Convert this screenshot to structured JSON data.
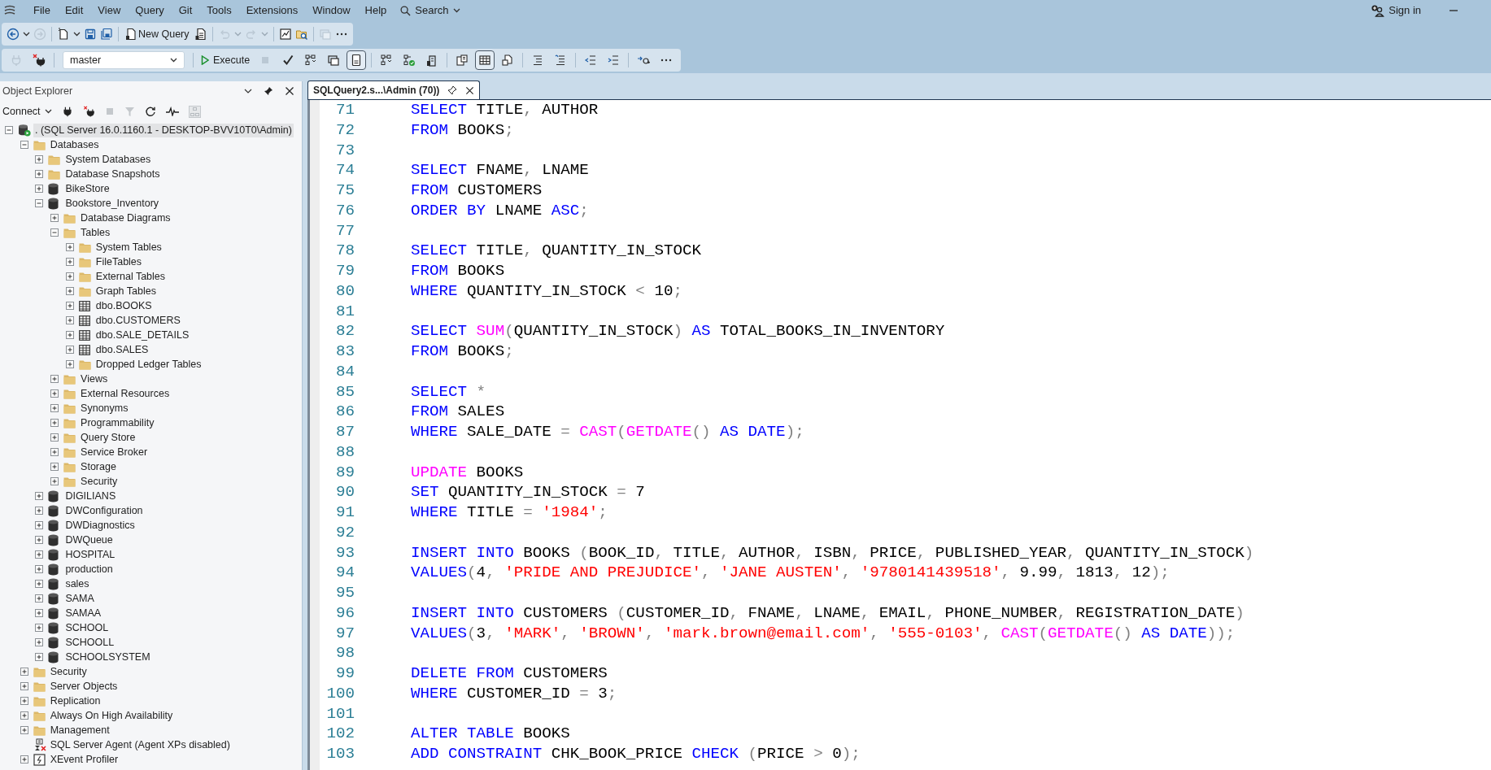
{
  "menu_bar": {
    "items": [
      "File",
      "Edit",
      "View",
      "Query",
      "Git",
      "Tools",
      "Extensions",
      "Window",
      "Help"
    ],
    "search": "Search",
    "sign_in": "Sign in"
  },
  "toolbar_1": [
    {
      "kind": "back",
      "disabled": false
    },
    {
      "kind": "dropdown",
      "disabled": false
    },
    {
      "kind": "forward",
      "disabled": true
    },
    {
      "kind": "separator"
    },
    {
      "kind": "new-file",
      "disabled": false
    },
    {
      "kind": "dropdown",
      "disabled": false
    },
    {
      "kind": "save",
      "disabled": false
    },
    {
      "kind": "save-all",
      "disabled": false
    },
    {
      "kind": "separator"
    },
    {
      "kind": "new-query",
      "label": "New Query",
      "disabled": false
    },
    {
      "kind": "document",
      "disabled": false
    },
    {
      "kind": "separator"
    },
    {
      "kind": "undo",
      "disabled": true
    },
    {
      "kind": "dropdown",
      "disabled": true
    },
    {
      "kind": "redo",
      "disabled": true
    },
    {
      "kind": "dropdown",
      "disabled": true
    },
    {
      "kind": "separator"
    },
    {
      "kind": "report",
      "disabled": false
    },
    {
      "kind": "open-folder",
      "disabled": false
    },
    {
      "kind": "separator"
    },
    {
      "kind": "window",
      "disabled": true
    },
    {
      "kind": "more",
      "disabled": false
    }
  ],
  "toolbar_2": [
    {
      "kind": "plug",
      "disabled": true
    },
    {
      "kind": "disconnect",
      "disabled": false
    },
    {
      "kind": "separator"
    },
    {
      "kind": "database-select",
      "value": "master"
    },
    {
      "kind": "separator"
    },
    {
      "kind": "execute",
      "label": "Execute",
      "disabled": false
    },
    {
      "kind": "stop",
      "disabled": true
    },
    {
      "kind": "check",
      "disabled": false
    },
    {
      "kind": "plan",
      "disabled": false,
      "selected": false
    },
    {
      "kind": "window",
      "disabled": false,
      "selected": false
    },
    {
      "kind": "form",
      "disabled": false,
      "selected": true
    },
    {
      "kind": "separator"
    },
    {
      "kind": "plan",
      "disabled": false,
      "selected": false
    },
    {
      "kind": "plan-check",
      "disabled": false,
      "selected": false
    },
    {
      "kind": "chart",
      "disabled": false,
      "selected": false
    },
    {
      "kind": "separator"
    },
    {
      "kind": "text",
      "disabled": false,
      "selected": false
    },
    {
      "kind": "grid",
      "disabled": false,
      "selected": true
    },
    {
      "kind": "file",
      "disabled": false,
      "selected": false
    },
    {
      "kind": "separator"
    },
    {
      "kind": "comment",
      "disabled": false
    },
    {
      "kind": "uncomment",
      "disabled": false
    },
    {
      "kind": "separator"
    },
    {
      "kind": "outdent",
      "disabled": false
    },
    {
      "kind": "indent",
      "disabled": false
    },
    {
      "kind": "separator"
    },
    {
      "kind": "parameters",
      "disabled": false
    },
    {
      "kind": "more",
      "disabled": false
    }
  ],
  "object_explorer": {
    "title": "Object Explorer",
    "connect": "Connect",
    "tree": [
      {
        "label": ". (SQL Server 16.0.1160.1 - DESKTOP-BVV10T0\\Admin)",
        "kind": "server",
        "expanded": true,
        "selected": true,
        "children": [
          {
            "label": "Databases",
            "kind": "folder",
            "expanded": true,
            "selected": false,
            "children": [
              {
                "label": "System Databases",
                "kind": "folder",
                "expanded": false,
                "selected": false
              },
              {
                "label": "Database Snapshots",
                "kind": "folder",
                "expanded": false,
                "selected": false
              },
              {
                "label": "BikeStore",
                "kind": "database",
                "expanded": false,
                "selected": false
              },
              {
                "label": "Bookstore_Inventory",
                "kind": "database",
                "expanded": true,
                "selected": false,
                "children": [
                  {
                    "label": "Database Diagrams",
                    "kind": "folder",
                    "expanded": false,
                    "selected": false
                  },
                  {
                    "label": "Tables",
                    "kind": "folder",
                    "expanded": true,
                    "selected": false,
                    "children": [
                      {
                        "label": "System Tables",
                        "kind": "folder",
                        "expanded": false,
                        "selected": false
                      },
                      {
                        "label": "FileTables",
                        "kind": "folder",
                        "expanded": false,
                        "selected": false
                      },
                      {
                        "label": "External Tables",
                        "kind": "folder",
                        "expanded": false,
                        "selected": false
                      },
                      {
                        "label": "Graph Tables",
                        "kind": "folder",
                        "expanded": false,
                        "selected": false
                      },
                      {
                        "label": "dbo.BOOKS",
                        "kind": "table",
                        "expanded": false,
                        "selected": false
                      },
                      {
                        "label": "dbo.CUSTOMERS",
                        "kind": "table",
                        "expanded": false,
                        "selected": false
                      },
                      {
                        "label": "dbo.SALE_DETAILS",
                        "kind": "table",
                        "expanded": false,
                        "selected": false
                      },
                      {
                        "label": "dbo.SALES",
                        "kind": "table",
                        "expanded": false,
                        "selected": false
                      },
                      {
                        "label": "Dropped Ledger Tables",
                        "kind": "folder",
                        "expanded": false,
                        "selected": false
                      }
                    ]
                  },
                  {
                    "label": "Views",
                    "kind": "folder",
                    "expanded": false,
                    "selected": false
                  },
                  {
                    "label": "External Resources",
                    "kind": "folder",
                    "expanded": false,
                    "selected": false
                  },
                  {
                    "label": "Synonyms",
                    "kind": "folder",
                    "expanded": false,
                    "selected": false
                  },
                  {
                    "label": "Programmability",
                    "kind": "folder",
                    "expanded": false,
                    "selected": false
                  },
                  {
                    "label": "Query Store",
                    "kind": "folder",
                    "expanded": false,
                    "selected": false
                  },
                  {
                    "label": "Service Broker",
                    "kind": "folder",
                    "expanded": false,
                    "selected": false
                  },
                  {
                    "label": "Storage",
                    "kind": "folder",
                    "expanded": false,
                    "selected": false
                  },
                  {
                    "label": "Security",
                    "kind": "folder",
                    "expanded": false,
                    "selected": false
                  }
                ]
              },
              {
                "label": "DIGILIANS",
                "kind": "database",
                "expanded": false,
                "selected": false
              },
              {
                "label": "DWConfiguration",
                "kind": "database",
                "expanded": false,
                "selected": false
              },
              {
                "label": "DWDiagnostics",
                "kind": "database",
                "expanded": false,
                "selected": false
              },
              {
                "label": "DWQueue",
                "kind": "database",
                "expanded": false,
                "selected": false
              },
              {
                "label": "HOSPITAL",
                "kind": "database",
                "expanded": false,
                "selected": false
              },
              {
                "label": "production",
                "kind": "database",
                "expanded": false,
                "selected": false
              },
              {
                "label": "sales",
                "kind": "database",
                "expanded": false,
                "selected": false
              },
              {
                "label": "SAMA",
                "kind": "database",
                "expanded": false,
                "selected": false
              },
              {
                "label": "SAMAA",
                "kind": "database",
                "expanded": false,
                "selected": false
              },
              {
                "label": "SCHOOL",
                "kind": "database",
                "expanded": false,
                "selected": false
              },
              {
                "label": "SCHOOLL",
                "kind": "database",
                "expanded": false,
                "selected": false
              },
              {
                "label": "SCHOOLSYSTEM",
                "kind": "database",
                "expanded": false,
                "selected": false
              }
            ]
          },
          {
            "label": "Security",
            "kind": "folder",
            "expanded": false,
            "selected": false
          },
          {
            "label": "Server Objects",
            "kind": "folder",
            "expanded": false,
            "selected": false
          },
          {
            "label": "Replication",
            "kind": "folder",
            "expanded": false,
            "selected": false
          },
          {
            "label": "Always On High Availability",
            "kind": "folder",
            "expanded": false,
            "selected": false
          },
          {
            "label": "Management",
            "kind": "folder",
            "expanded": false,
            "selected": false
          },
          {
            "label": "SQL Server Agent (Agent XPs disabled)",
            "kind": "agent",
            "selected": false
          },
          {
            "label": "XEvent Profiler",
            "kind": "profiler",
            "expanded": false,
            "selected": false
          }
        ]
      }
    ]
  },
  "editor": {
    "tab": {
      "title": "SQLQuery2.s...\\Admin (70))",
      "selected": true
    },
    "lines": [
      {
        "n": "71",
        "tokens": [
          {
            "kind": "kw",
            "text": "SELECT"
          },
          {
            "kind": "id",
            "text": " TITLE"
          },
          {
            "kind": "op",
            "text": ","
          },
          {
            "kind": "id",
            "text": " AUTHOR"
          }
        ]
      },
      {
        "n": "72",
        "tokens": [
          {
            "kind": "kw",
            "text": "FROM"
          },
          {
            "kind": "id",
            "text": " BOOKS"
          },
          {
            "kind": "op",
            "text": ";"
          }
        ]
      },
      {
        "n": "73"
      },
      {
        "n": "74",
        "tokens": [
          {
            "kind": "kw",
            "text": "SELECT"
          },
          {
            "kind": "id",
            "text": " FNAME"
          },
          {
            "kind": "op",
            "text": ","
          },
          {
            "kind": "id",
            "text": " LNAME"
          }
        ]
      },
      {
        "n": "75",
        "tokens": [
          {
            "kind": "kw",
            "text": "FROM"
          },
          {
            "kind": "id",
            "text": " CUSTOMERS"
          }
        ]
      },
      {
        "n": "76",
        "tokens": [
          {
            "kind": "kw",
            "text": "ORDER BY"
          },
          {
            "kind": "id",
            "text": " LNAME "
          },
          {
            "kind": "kw",
            "text": "ASC"
          },
          {
            "kind": "op",
            "text": ";"
          }
        ]
      },
      {
        "n": "77"
      },
      {
        "n": "78",
        "tokens": [
          {
            "kind": "kw",
            "text": "SELECT"
          },
          {
            "kind": "id",
            "text": " TITLE"
          },
          {
            "kind": "op",
            "text": ","
          },
          {
            "kind": "id",
            "text": " QUANTITY_IN_STOCK"
          }
        ]
      },
      {
        "n": "79",
        "tokens": [
          {
            "kind": "kw",
            "text": "FROM"
          },
          {
            "kind": "id",
            "text": " BOOKS"
          }
        ]
      },
      {
        "n": "80",
        "tokens": [
          {
            "kind": "kw",
            "text": "WHERE"
          },
          {
            "kind": "id",
            "text": " QUANTITY_IN_STOCK "
          },
          {
            "kind": "op",
            "text": "<"
          },
          {
            "kind": "id",
            "text": " 10"
          },
          {
            "kind": "op",
            "text": ";"
          }
        ]
      },
      {
        "n": "81"
      },
      {
        "n": "82",
        "tokens": [
          {
            "kind": "kw",
            "text": "SELECT "
          },
          {
            "kind": "fn",
            "text": "SUM"
          },
          {
            "kind": "op",
            "text": "("
          },
          {
            "kind": "id",
            "text": "QUANTITY_IN_STOCK"
          },
          {
            "kind": "op",
            "text": ")"
          },
          {
            "kind": "kw",
            "text": " AS"
          },
          {
            "kind": "id",
            "text": " TOTAL_BOOKS_IN_INVENTORY"
          }
        ]
      },
      {
        "n": "83",
        "tokens": [
          {
            "kind": "kw",
            "text": "FROM"
          },
          {
            "kind": "id",
            "text": " BOOKS"
          },
          {
            "kind": "op",
            "text": ";"
          }
        ]
      },
      {
        "n": "84"
      },
      {
        "n": "85",
        "tokens": [
          {
            "kind": "kw",
            "text": "SELECT "
          },
          {
            "kind": "op",
            "text": "*"
          }
        ]
      },
      {
        "n": "86",
        "tokens": [
          {
            "kind": "kw",
            "text": "FROM"
          },
          {
            "kind": "id",
            "text": " SALES"
          }
        ]
      },
      {
        "n": "87",
        "tokens": [
          {
            "kind": "kw",
            "text": "WHERE"
          },
          {
            "kind": "id",
            "text": " SALE_DATE "
          },
          {
            "kind": "op",
            "text": "="
          },
          {
            "kind": "fn",
            "text": " CAST"
          },
          {
            "kind": "op",
            "text": "("
          },
          {
            "kind": "fn",
            "text": "GETDATE"
          },
          {
            "kind": "op",
            "text": "()"
          },
          {
            "kind": "kw",
            "text": " AS DATE"
          },
          {
            "kind": "op",
            "text": ");"
          }
        ]
      },
      {
        "n": "88"
      },
      {
        "n": "89",
        "tokens": [
          {
            "kind": "fn",
            "text": "UPDATE"
          },
          {
            "kind": "id",
            "text": " BOOKS"
          }
        ]
      },
      {
        "n": "90",
        "tokens": [
          {
            "kind": "kw",
            "text": "SET"
          },
          {
            "kind": "id",
            "text": " QUANTITY_IN_STOCK "
          },
          {
            "kind": "op",
            "text": "="
          },
          {
            "kind": "id",
            "text": " 7"
          }
        ]
      },
      {
        "n": "91",
        "tokens": [
          {
            "kind": "kw",
            "text": "WHERE"
          },
          {
            "kind": "id",
            "text": " TITLE "
          },
          {
            "kind": "op",
            "text": "="
          },
          {
            "kind": "str",
            "text": " '1984'"
          },
          {
            "kind": "op",
            "text": ";"
          }
        ]
      },
      {
        "n": "92"
      },
      {
        "n": "93",
        "tokens": [
          {
            "kind": "kw",
            "text": "INSERT INTO"
          },
          {
            "kind": "id",
            "text": " BOOKS "
          },
          {
            "kind": "op",
            "text": "("
          },
          {
            "kind": "id",
            "text": "BOOK_ID"
          },
          {
            "kind": "op",
            "text": ","
          },
          {
            "kind": "id",
            "text": " TITLE"
          },
          {
            "kind": "op",
            "text": ","
          },
          {
            "kind": "id",
            "text": " AUTHOR"
          },
          {
            "kind": "op",
            "text": ","
          },
          {
            "kind": "id",
            "text": " ISBN"
          },
          {
            "kind": "op",
            "text": ","
          },
          {
            "kind": "id",
            "text": " PRICE"
          },
          {
            "kind": "op",
            "text": ","
          },
          {
            "kind": "id",
            "text": " PUBLISHED_YEAR"
          },
          {
            "kind": "op",
            "text": ","
          },
          {
            "kind": "id",
            "text": " QUANTITY_IN_STOCK"
          },
          {
            "kind": "op",
            "text": ")"
          }
        ]
      },
      {
        "n": "94",
        "tokens": [
          {
            "kind": "kw",
            "text": "VALUES"
          },
          {
            "kind": "op",
            "text": "("
          },
          {
            "kind": "id",
            "text": "4"
          },
          {
            "kind": "op",
            "text": ","
          },
          {
            "kind": "str",
            "text": " 'PRIDE AND PREJUDICE'"
          },
          {
            "kind": "op",
            "text": ","
          },
          {
            "kind": "str",
            "text": " 'JANE AUSTEN'"
          },
          {
            "kind": "op",
            "text": ","
          },
          {
            "kind": "str",
            "text": " '9780141439518'"
          },
          {
            "kind": "op",
            "text": ","
          },
          {
            "kind": "id",
            "text": " 9.99"
          },
          {
            "kind": "op",
            "text": ","
          },
          {
            "kind": "id",
            "text": " 1813"
          },
          {
            "kind": "op",
            "text": ","
          },
          {
            "kind": "id",
            "text": " 12"
          },
          {
            "kind": "op",
            "text": ");"
          }
        ]
      },
      {
        "n": "95"
      },
      {
        "n": "96",
        "tokens": [
          {
            "kind": "kw",
            "text": "INSERT INTO"
          },
          {
            "kind": "id",
            "text": " CUSTOMERS "
          },
          {
            "kind": "op",
            "text": "("
          },
          {
            "kind": "id",
            "text": "CUSTOMER_ID"
          },
          {
            "kind": "op",
            "text": ","
          },
          {
            "kind": "id",
            "text": " FNAME"
          },
          {
            "kind": "op",
            "text": ","
          },
          {
            "kind": "id",
            "text": " LNAME"
          },
          {
            "kind": "op",
            "text": ","
          },
          {
            "kind": "id",
            "text": " EMAIL"
          },
          {
            "kind": "op",
            "text": ","
          },
          {
            "kind": "id",
            "text": " PHONE_NUMBER"
          },
          {
            "kind": "op",
            "text": ","
          },
          {
            "kind": "id",
            "text": " REGISTRATION_DATE"
          },
          {
            "kind": "op",
            "text": ")"
          }
        ]
      },
      {
        "n": "97",
        "tokens": [
          {
            "kind": "kw",
            "text": "VALUES"
          },
          {
            "kind": "op",
            "text": "("
          },
          {
            "kind": "id",
            "text": "3"
          },
          {
            "kind": "op",
            "text": ","
          },
          {
            "kind": "str",
            "text": " 'MARK'"
          },
          {
            "kind": "op",
            "text": ","
          },
          {
            "kind": "str",
            "text": " 'BROWN'"
          },
          {
            "kind": "op",
            "text": ","
          },
          {
            "kind": "str",
            "text": " 'mark.brown@email.com'"
          },
          {
            "kind": "op",
            "text": ","
          },
          {
            "kind": "str",
            "text": " '555-0103'"
          },
          {
            "kind": "op",
            "text": ","
          },
          {
            "kind": "fn",
            "text": " CAST"
          },
          {
            "kind": "op",
            "text": "("
          },
          {
            "kind": "fn",
            "text": "GETDATE"
          },
          {
            "kind": "op",
            "text": "()"
          },
          {
            "kind": "kw",
            "text": " AS DATE"
          },
          {
            "kind": "op",
            "text": "));"
          }
        ]
      },
      {
        "n": "98"
      },
      {
        "n": "99",
        "tokens": [
          {
            "kind": "kw",
            "text": "DELETE FROM"
          },
          {
            "kind": "id",
            "text": " CUSTOMERS"
          }
        ]
      },
      {
        "n": "100",
        "tokens": [
          {
            "kind": "kw",
            "text": "WHERE"
          },
          {
            "kind": "id",
            "text": " CUSTOMER_ID "
          },
          {
            "kind": "op",
            "text": "="
          },
          {
            "kind": "id",
            "text": " 3"
          },
          {
            "kind": "op",
            "text": ";"
          }
        ]
      },
      {
        "n": "101"
      },
      {
        "n": "102",
        "tokens": [
          {
            "kind": "kw",
            "text": "ALTER TABLE"
          },
          {
            "kind": "id",
            "text": " BOOKS"
          }
        ]
      },
      {
        "n": "103",
        "tokens": [
          {
            "kind": "kw",
            "text": "ADD CONSTRAINT"
          },
          {
            "kind": "id",
            "text": " CHK_BOOK_PRICE "
          },
          {
            "kind": "kw",
            "text": "CHECK"
          },
          {
            "kind": "op",
            "text": " ("
          },
          {
            "kind": "id",
            "text": "PRICE "
          },
          {
            "kind": "op",
            "text": ">"
          },
          {
            "kind": "id",
            "text": " 0"
          },
          {
            "kind": "op",
            "text": ");"
          }
        ]
      }
    ]
  }
}
